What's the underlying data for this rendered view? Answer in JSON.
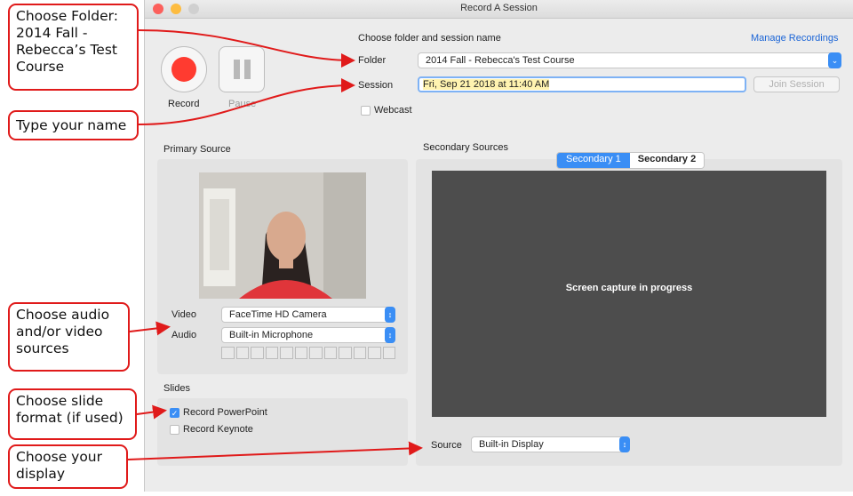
{
  "window": {
    "title": "Record A Session"
  },
  "controls": {
    "record_label": "Record",
    "pause_label": "Pause"
  },
  "header": {
    "choose_text": "Choose folder and session name",
    "manage_link": "Manage Recordings"
  },
  "folder": {
    "label": "Folder",
    "value": "2014 Fall - Rebecca's Test Course"
  },
  "session": {
    "label": "Session",
    "value": "Fri, Sep 21 2018 at 11:40 AM",
    "join_label": "Join Session"
  },
  "webcast": {
    "label": "Webcast",
    "checked": false
  },
  "primary": {
    "heading": "Primary Source",
    "video_label": "Video",
    "video_value": "FaceTime HD Camera",
    "audio_label": "Audio",
    "audio_value": "Built-in Microphone"
  },
  "slides": {
    "heading": "Slides",
    "powerpoint_label": "Record PowerPoint",
    "powerpoint_checked": true,
    "keynote_label": "Record Keynote",
    "keynote_checked": false
  },
  "secondary": {
    "heading": "Secondary Sources",
    "tabs": [
      "Secondary 1",
      "Secondary 2"
    ],
    "active_tab": "Secondary 1",
    "capture_text": "Screen capture in progress",
    "source_label": "Source",
    "source_value": "Built-in Display"
  },
  "callouts": {
    "folder": "Choose Folder: 2014 Fall - Rebecca’s Test Course",
    "name": "Type your name",
    "av": "Choose audio and/or video sources",
    "slides": "Choose slide format (if used)",
    "display": "Choose your display"
  },
  "colors": {
    "accent": "#3a8ef5",
    "record": "#ff3b30",
    "callout_border": "#e01a1a",
    "preview_bg": "#4d4d4d"
  }
}
